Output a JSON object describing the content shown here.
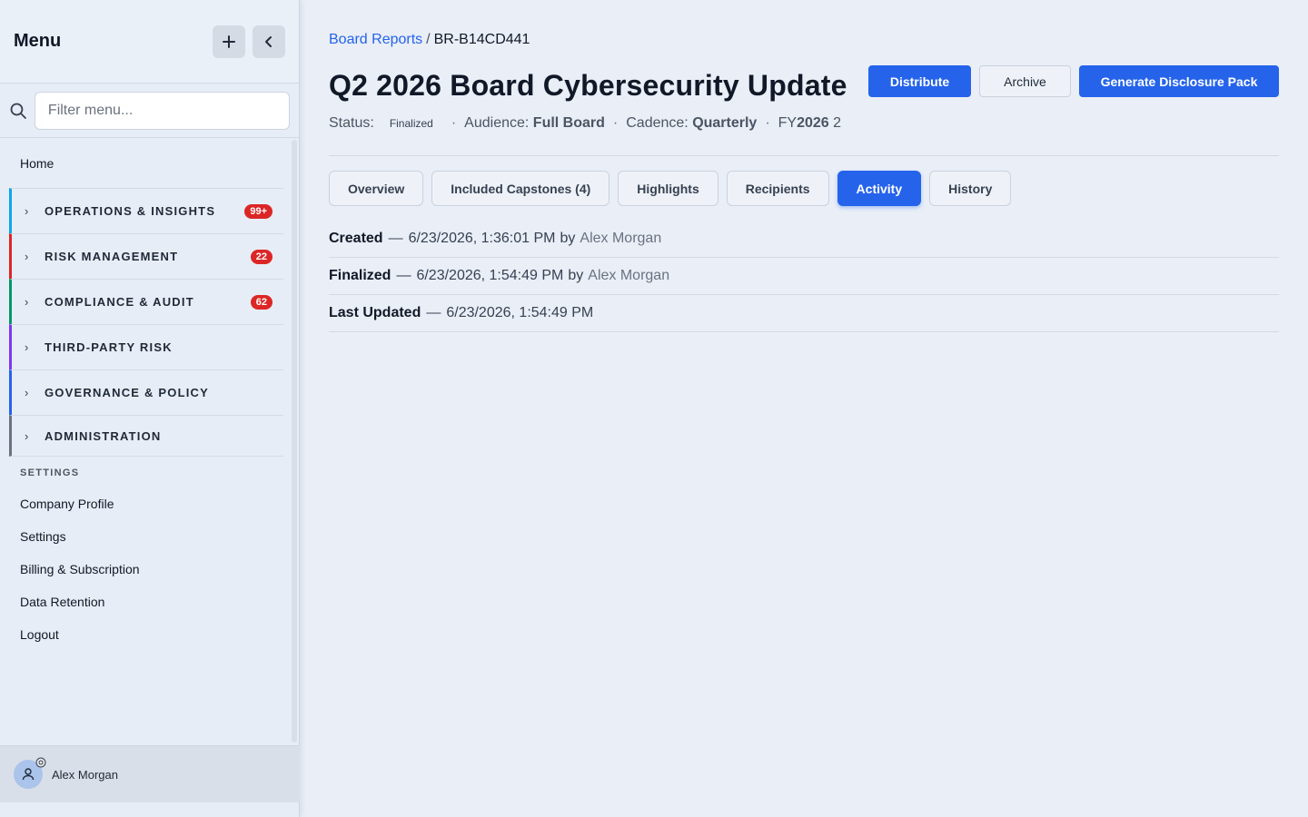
{
  "sidebar": {
    "title": "Menu",
    "add_label": "+",
    "search_placeholder": "Filter menu...",
    "home": "Home",
    "groups": [
      {
        "label": "OPERATIONS & INSIGHTS",
        "badge": "99+",
        "color": "#0ea5e9"
      },
      {
        "label": "RISK MANAGEMENT",
        "badge": "22",
        "color": "#dc2626"
      },
      {
        "label": "COMPLIANCE & AUDIT",
        "badge": "62",
        "color": "#059669"
      },
      {
        "label": "THIRD-PARTY RISK",
        "badge": "",
        "color": "#7c3aed"
      },
      {
        "label": "GOVERNANCE & POLICY",
        "badge": "",
        "color": "#2563eb"
      },
      {
        "label": "ADMINISTRATION",
        "badge": "",
        "color": "#6b7280"
      }
    ],
    "settings_section": "SETTINGS",
    "settings_links": [
      "Company Profile",
      "Settings",
      "Billing & Subscription",
      "Data Retention",
      "Logout"
    ],
    "user_name": "Alex Morgan"
  },
  "breadcrumb": {
    "parent": "Board Reports",
    "separator": "/",
    "current": "BR-B14CD441"
  },
  "header": {
    "title": "Q2 2026 Board Cybersecurity Update",
    "actions": {
      "distribute": "Distribute",
      "archive": "Archive",
      "generate": "Generate Disclosure Pack"
    }
  },
  "meta": {
    "status_label": "Status:",
    "status_value": "Finalized",
    "audience_label": "Audience:",
    "audience_value": "Full Board",
    "cadence_label": "Cadence:",
    "cadence_value": "Quarterly",
    "fy_prefix": "FY",
    "fy_year": "2026",
    "fy_suffix": "2",
    "dot": "·"
  },
  "tabs": [
    {
      "label": "Overview",
      "active": false
    },
    {
      "label": "Included Capstones (4)",
      "active": false
    },
    {
      "label": "Highlights",
      "active": false
    },
    {
      "label": "Recipients",
      "active": false
    },
    {
      "label": "Activity",
      "active": true
    },
    {
      "label": "History",
      "active": false
    }
  ],
  "activity": [
    {
      "label": "Created",
      "dash": "—",
      "time": "6/23/2026, 1:36:01 PM",
      "by": "by",
      "who": "Alex Morgan"
    },
    {
      "label": "Finalized",
      "dash": "—",
      "time": "6/23/2026, 1:54:49 PM",
      "by": "by",
      "who": "Alex Morgan"
    },
    {
      "label": "Last Updated",
      "dash": "—",
      "time": "6/23/2026, 1:54:49 PM",
      "by": "",
      "who": ""
    }
  ],
  "colors": {
    "accent": "#2563eb",
    "badge": "#dc2626"
  }
}
